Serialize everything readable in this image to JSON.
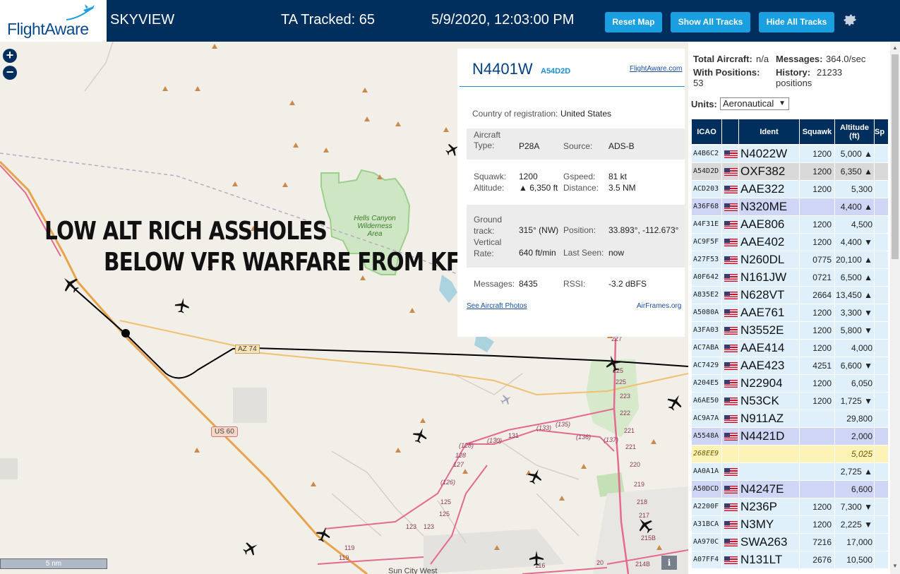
{
  "header": {
    "logo_text": "FlightAware",
    "app_title": "SKYVIEW",
    "ta_tracked": "TA Tracked: 65",
    "datetime": "5/9/2020, 12:03:00 PM",
    "buttons": {
      "reset": "Reset Map",
      "show_all": "Show All Tracks",
      "hide_all": "Hide All Tracks"
    }
  },
  "map": {
    "zoom_in": "+",
    "zoom_out": "−",
    "overlay_line1": "LOW ALT RICH ASSHOLES",
    "overlay_line2": "BELOW VFR WARFARE FROM KFFZ",
    "scale": "5 nm",
    "info": "i",
    "labels": {
      "wilderness": [
        "Hells Canyon",
        "Wilderness",
        "Area"
      ],
      "az74": "AZ 74",
      "us60": "US 60",
      "sun_city_west": "Sun City West",
      "r227": "227",
      "r225a": "225",
      "r225b": "225",
      "r223": "223",
      "r222": "222",
      "r221a": "221",
      "r221b": "221",
      "r220": "220",
      "r219": "219",
      "r218": "218",
      "r217": "217",
      "r216": "216",
      "r215b": "215B",
      "r214b": "214B",
      "r128": "(128)",
      "r127": "127",
      "r126": "(126)",
      "r125a": "125",
      "r125b": "125",
      "r123a": "123",
      "r123b": "123",
      "r119a": "119",
      "r119b": "119",
      "r130": "(130)",
      "r131": "131",
      "r133": "(133)",
      "r135": "(135)",
      "r136": "(136)",
      "r137": "(137)",
      "r128b": "128",
      "r20": "20",
      "r116": "116"
    },
    "colors": {
      "highway": "#e8a44a",
      "arterial": "#e46a8f",
      "track": "#000000",
      "route": "#f0c070",
      "park": "#9bcf8b"
    }
  },
  "detail": {
    "ident": "N4401W",
    "icao": "A54D2D",
    "link": "FlightAware.com",
    "country_label": "Country of registration:",
    "country_value": "United States",
    "aircraft_type_label": "Aircraft Type:",
    "aircraft_type_value": "P28A",
    "source_label": "Source:",
    "source_value": "ADS-B",
    "squawk_label": "Squawk:",
    "squawk_value": "1200",
    "gspeed_label": "Gspeed:",
    "gspeed_value": "81 kt",
    "altitude_label": "Altitude:",
    "altitude_value": "▲ 6,350 ft",
    "distance_label": "Distance:",
    "distance_value": "3.5 NM",
    "track_label": "Ground track:",
    "track_value": "315° (NW)",
    "position_label": "Position:",
    "position_value": "33.893°, -112.673°",
    "vrate_label": "Vertical Rate:",
    "vrate_value": "640 ft/min",
    "lastseen_label": "Last Seen:",
    "lastseen_value": "now",
    "messages_label": "Messages:",
    "messages_value": "8435",
    "rssi_label": "RSSI:",
    "rssi_value": "-3.2 dBFS",
    "photos_link": "See Aircraft Photos",
    "airframes_link": "AirFrames.org"
  },
  "side": {
    "total_aircraft_label": "Total Aircraft:",
    "total_aircraft_value": "n/a",
    "messages_label": "Messages:",
    "messages_value": "364.0/sec",
    "with_positions_label": "With Positions:",
    "with_positions_value": "53",
    "history_label": "History:",
    "history_value": "21233",
    "history_unit": "positions",
    "units_label": "Units:",
    "units_value": "Aeronautical",
    "columns": {
      "icao": "ICAO",
      "ident": "Ident",
      "squawk": "Squawk",
      "altitude": "Altitude (ft)",
      "speed": "Sp"
    },
    "rows": [
      {
        "icao": "A4B6C2",
        "ident": "N4022W",
        "squawk": "1200",
        "altitude": "5,000 ▲",
        "flag": true,
        "style": ""
      },
      {
        "icao": "A54D2D",
        "ident": "OXF382",
        "squawk": "1200",
        "altitude": "6,350 ▲",
        "flag": true,
        "style": "sel"
      },
      {
        "icao": "ACD203",
        "ident": "AAE322",
        "squawk": "1200",
        "altitude": "5,300",
        "flag": true,
        "style": ""
      },
      {
        "icao": "A36F68",
        "ident": "N320ME",
        "squawk": "",
        "altitude": "4,400 ▲",
        "flag": true,
        "style": "purple"
      },
      {
        "icao": "A4F31E",
        "ident": "AAE806",
        "squawk": "1200",
        "altitude": "4,500",
        "flag": true,
        "style": ""
      },
      {
        "icao": "AC9F5F",
        "ident": "AAE402",
        "squawk": "1200",
        "altitude": "4,400 ▼",
        "flag": true,
        "style": ""
      },
      {
        "icao": "A27F53",
        "ident": "N260DL",
        "squawk": "0775",
        "altitude": "20,100 ▲",
        "flag": true,
        "style": ""
      },
      {
        "icao": "A0F642",
        "ident": "N161JW",
        "squawk": "0721",
        "altitude": "6,500 ▲",
        "flag": true,
        "style": ""
      },
      {
        "icao": "A835E2",
        "ident": "N628VT",
        "squawk": "2664",
        "altitude": "13,450 ▲",
        "flag": true,
        "style": ""
      },
      {
        "icao": "A5080A",
        "ident": "AAE761",
        "squawk": "1200",
        "altitude": "3,300 ▼",
        "flag": true,
        "style": ""
      },
      {
        "icao": "A3FA03",
        "ident": "N3552E",
        "squawk": "1200",
        "altitude": "5,800 ▼",
        "flag": true,
        "style": ""
      },
      {
        "icao": "AC7ABA",
        "ident": "AAE414",
        "squawk": "1200",
        "altitude": "4,000",
        "flag": true,
        "style": ""
      },
      {
        "icao": "AC7429",
        "ident": "AAE423",
        "squawk": "4251",
        "altitude": "6,600 ▼",
        "flag": true,
        "style": ""
      },
      {
        "icao": "A204E5",
        "ident": "N22904",
        "squawk": "1200",
        "altitude": "6,050",
        "flag": true,
        "style": ""
      },
      {
        "icao": "A6AE50",
        "ident": "N53CK",
        "squawk": "1200",
        "altitude": "1,725 ▼",
        "flag": true,
        "style": ""
      },
      {
        "icao": "AC9A7A",
        "ident": "N911AZ",
        "squawk": "",
        "altitude": "29,800",
        "flag": true,
        "style": ""
      },
      {
        "icao": "A5548A",
        "ident": "N4421D",
        "squawk": "",
        "altitude": "2,000",
        "flag": true,
        "style": "purple"
      },
      {
        "icao": "268EE9",
        "ident": "",
        "squawk": "",
        "altitude": "5,025",
        "flag": false,
        "style": "yellow"
      },
      {
        "icao": "AA0A1A",
        "ident": "",
        "squawk": "",
        "altitude": "2,725 ▲",
        "flag": true,
        "style": ""
      },
      {
        "icao": "A50DCD",
        "ident": "N4247E",
        "squawk": "",
        "altitude": "6,600",
        "flag": true,
        "style": "purple"
      },
      {
        "icao": "A2200F",
        "ident": "N236P",
        "squawk": "1200",
        "altitude": "7,300 ▼",
        "flag": true,
        "style": ""
      },
      {
        "icao": "A31BCA",
        "ident": "N3MY",
        "squawk": "1200",
        "altitude": "2,225 ▼",
        "flag": true,
        "style": ""
      },
      {
        "icao": "AA970C",
        "ident": "SWA263",
        "squawk": "7216",
        "altitude": "17,000",
        "flag": true,
        "style": ""
      },
      {
        "icao": "A07FF4",
        "ident": "N131LT",
        "squawk": "2676",
        "altitude": "10,500",
        "flag": true,
        "style": ""
      }
    ]
  }
}
